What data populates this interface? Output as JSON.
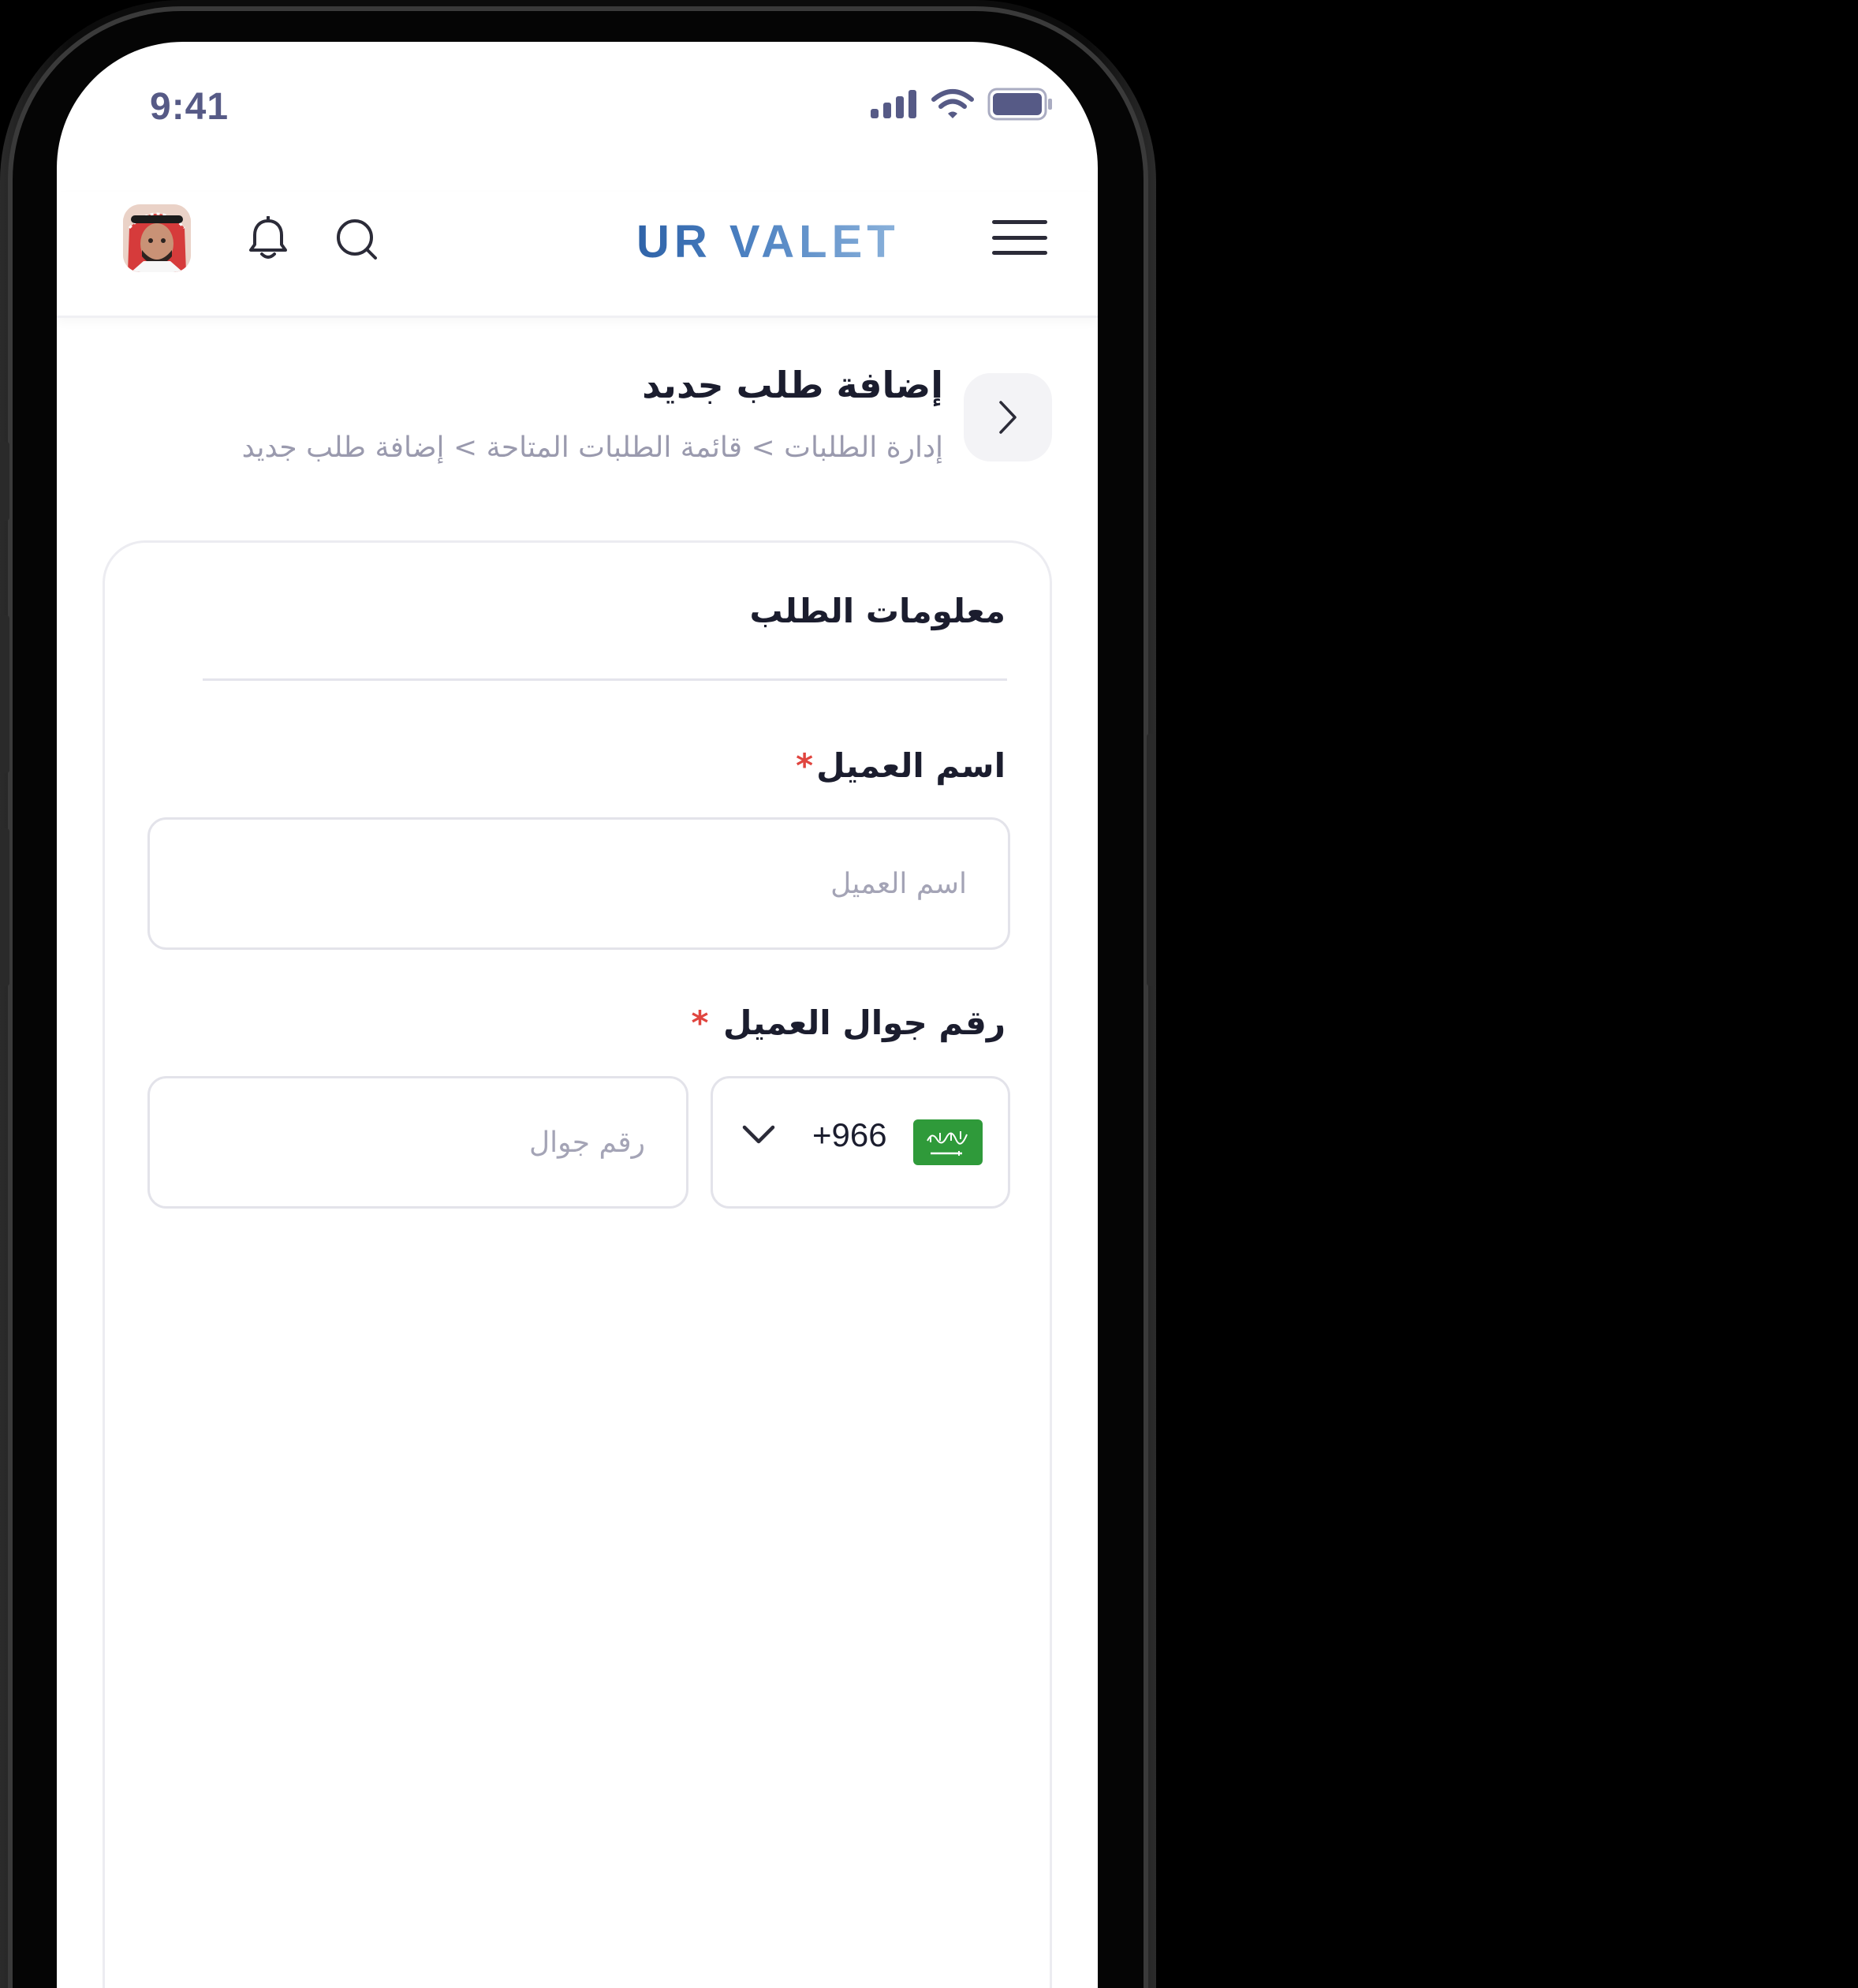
{
  "status_bar": {
    "time": "9:41"
  },
  "header": {
    "brand": "UR VALET",
    "icons": {
      "avatar": "user-avatar",
      "notifications": "bell-icon",
      "search": "search-icon",
      "menu": "hamburger-menu-icon"
    }
  },
  "page": {
    "title": "إضافة طلب جديد",
    "breadcrumb": "إدارة الطلبات > قائمة الطلبات المتاحة > إضافة طلب جديد"
  },
  "form": {
    "section_title": "معلومات الطلب",
    "customer_name": {
      "label": "اسم العميل",
      "required_mark": "*",
      "placeholder": "اسم العميل",
      "value": ""
    },
    "customer_phone": {
      "label": "رقم جوال العميل",
      "required_mark": "*",
      "placeholder": "رقم جوال",
      "value": "",
      "country_code": "+966",
      "country_flag": "saudi-arabia-flag"
    }
  },
  "colors": {
    "brand_blue": "#2f63a8",
    "required_red": "#e0453f",
    "text_dark": "#1b1d2e",
    "text_muted": "#9a9aae",
    "flag_green": "#2f9a3a"
  }
}
